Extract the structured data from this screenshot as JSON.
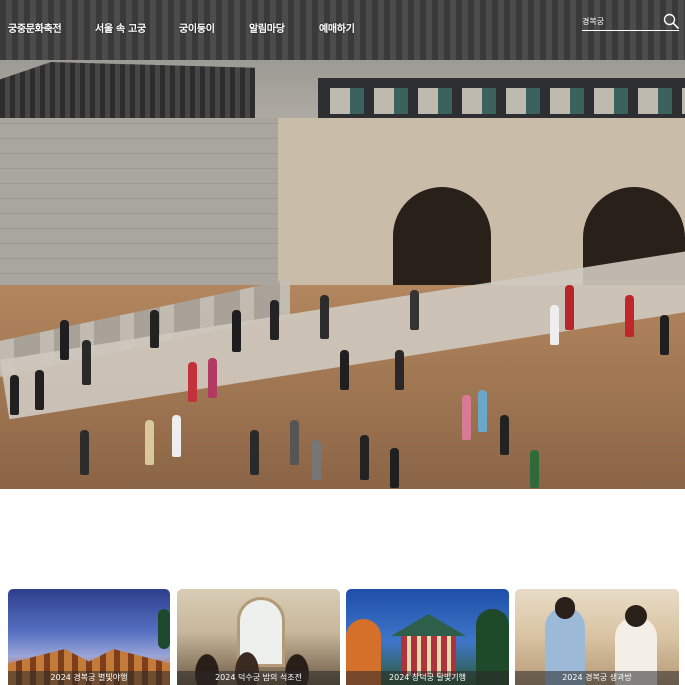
{
  "nav": {
    "items": [
      {
        "label": "궁중문화축전"
      },
      {
        "label": "서울 속 고궁"
      },
      {
        "label": "궁이둥이"
      },
      {
        "label": "알림마당"
      },
      {
        "label": "예매하기"
      }
    ]
  },
  "search": {
    "placeholder": "경복궁",
    "icon": "search-icon"
  },
  "cards": [
    {
      "caption": "2024 경복궁 별빛야행"
    },
    {
      "caption": "2024 덕수궁 밤의 석조전"
    },
    {
      "caption": "2024 창덕궁 달빛기행"
    },
    {
      "caption": "2024 경복궁 생과방"
    }
  ],
  "colors": {
    "nav_text": "#ffffff",
    "background": "#ffffff"
  }
}
